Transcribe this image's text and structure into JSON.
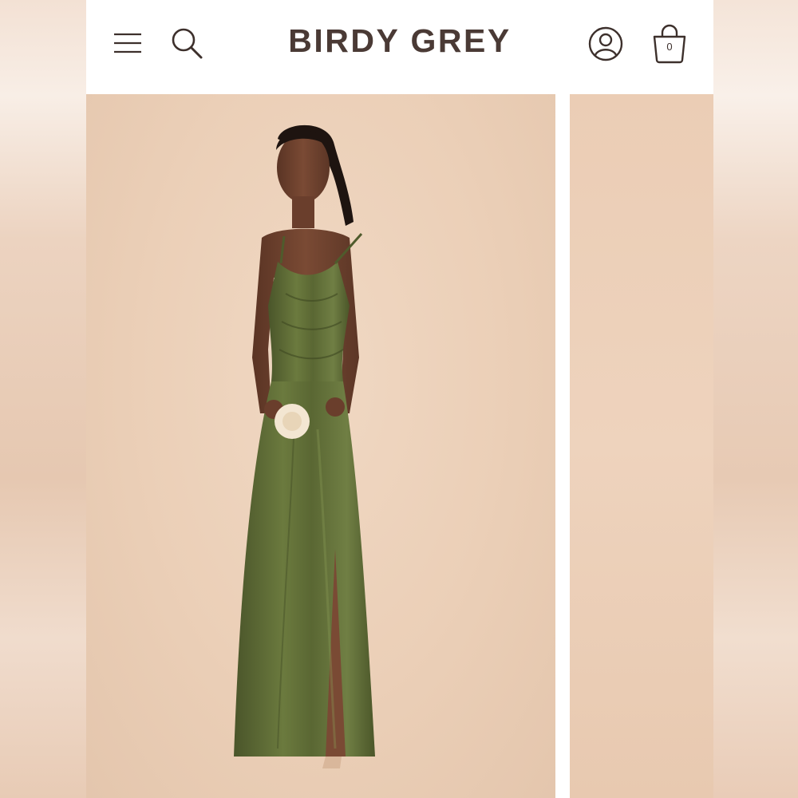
{
  "header": {
    "brand": "BIRDY GREY",
    "bag_count": "0",
    "icons": {
      "menu": "hamburger-menu-icon",
      "search": "search-icon",
      "account": "user-account-icon",
      "bag": "shopping-bag-icon"
    }
  },
  "gallery": {
    "main_image": "model-in-olive-satin-dress",
    "next_image": "product-image-partial",
    "colors": {
      "dress": "#5c6835",
      "backdrop": "#ebcfb7"
    }
  }
}
